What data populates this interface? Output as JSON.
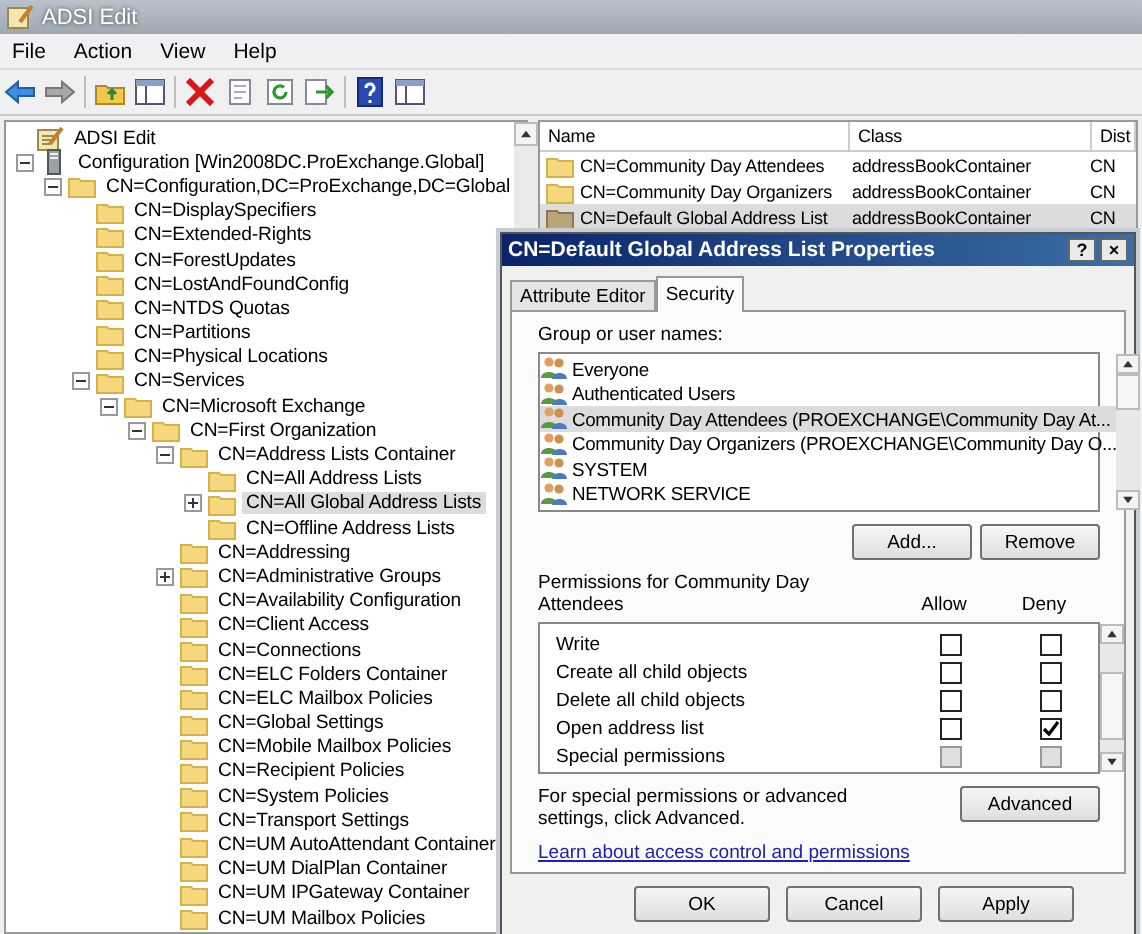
{
  "window": {
    "title": "ADSI Edit"
  },
  "menu": [
    "File",
    "Action",
    "View",
    "Help"
  ],
  "tree": {
    "items": [
      {
        "label": "ADSI Edit",
        "kind": "app",
        "selected": false,
        "children": [
          {
            "label": "Configuration [Win2008DC.ProExchange.Global]",
            "kind": "server",
            "expanded": true,
            "selected": false,
            "children": [
              {
                "label": "CN=Configuration,DC=ProExchange,DC=Global",
                "expanded": true,
                "selected": false,
                "children": [
                  {
                    "label": "CN=DisplaySpecifiers",
                    "selected": false
                  },
                  {
                    "label": "CN=Extended-Rights",
                    "selected": false
                  },
                  {
                    "label": "CN=ForestUpdates",
                    "selected": false
                  },
                  {
                    "label": "CN=LostAndFoundConfig",
                    "selected": false
                  },
                  {
                    "label": "CN=NTDS Quotas",
                    "selected": false
                  },
                  {
                    "label": "CN=Partitions",
                    "selected": false
                  },
                  {
                    "label": "CN=Physical Locations",
                    "selected": false
                  },
                  {
                    "label": "CN=Services",
                    "expanded": true,
                    "selected": false,
                    "children": [
                      {
                        "label": "CN=Microsoft Exchange",
                        "expanded": true,
                        "selected": false,
                        "children": [
                          {
                            "label": "CN=First Organization",
                            "expanded": true,
                            "selected": false,
                            "children": [
                              {
                                "label": "CN=Address Lists Container",
                                "expanded": true,
                                "selected": false,
                                "children": [
                                  {
                                    "label": "CN=All Address Lists",
                                    "selected": false
                                  },
                                  {
                                    "label": "CN=All Global Address Lists",
                                    "expanded": false,
                                    "selected": true
                                  },
                                  {
                                    "label": "CN=Offline Address Lists",
                                    "selected": false
                                  }
                                ]
                              },
                              {
                                "label": "CN=Addressing",
                                "selected": false
                              },
                              {
                                "label": "CN=Administrative Groups",
                                "expanded": false,
                                "selected": false
                              },
                              {
                                "label": "CN=Availability Configuration",
                                "selected": false
                              },
                              {
                                "label": "CN=Client Access",
                                "selected": false
                              },
                              {
                                "label": "CN=Connections",
                                "selected": false
                              },
                              {
                                "label": "CN=ELC Folders Container",
                                "selected": false
                              },
                              {
                                "label": "CN=ELC Mailbox Policies",
                                "selected": false
                              },
                              {
                                "label": "CN=Global Settings",
                                "selected": false
                              },
                              {
                                "label": "CN=Mobile Mailbox Policies",
                                "selected": false
                              },
                              {
                                "label": "CN=Recipient Policies",
                                "selected": false
                              },
                              {
                                "label": "CN=System Policies",
                                "selected": false
                              },
                              {
                                "label": "CN=Transport Settings",
                                "selected": false
                              },
                              {
                                "label": "CN=UM AutoAttendant Container",
                                "selected": false
                              },
                              {
                                "label": "CN=UM DialPlan Container",
                                "selected": false
                              },
                              {
                                "label": "CN=UM IPGateway Container",
                                "selected": false
                              },
                              {
                                "label": "CN=UM Mailbox Policies",
                                "selected": false
                              }
                            ]
                          }
                        ]
                      }
                    ]
                  }
                ]
              }
            ]
          }
        ]
      }
    ]
  },
  "list": {
    "columns": [
      "Name",
      "Class",
      "Dist"
    ],
    "rows": [
      {
        "name": "CN=Community Day Attendees",
        "class": "addressBookContainer",
        "column_3": "CN",
        "selected": false
      },
      {
        "name": "CN=Community Day Organizers",
        "class": "addressBookContainer",
        "column_3": "CN",
        "selected": false
      },
      {
        "name": "CN=Default Global Address List",
        "class": "addressBookContainer",
        "column_3": "CN",
        "selected": true
      }
    ]
  },
  "dialog": {
    "title": "CN=Default Global Address List Properties",
    "help": "?",
    "close": "×",
    "tabs": [
      {
        "label": "Attribute Editor",
        "selected": false
      },
      {
        "label": "Security",
        "selected": true
      }
    ],
    "group_label": "Group or user names:",
    "principals": [
      {
        "name": "Everyone",
        "selected": false
      },
      {
        "name": "Authenticated Users",
        "selected": false
      },
      {
        "name": "Community Day Attendees (PROEXCHANGE\\Community Day At...",
        "selected": true
      },
      {
        "name": "Community Day Organizers (PROEXCHANGE\\Community Day O...",
        "selected": false
      },
      {
        "name": "SYSTEM",
        "selected": false
      },
      {
        "name": "NETWORK SERVICE",
        "selected": false
      }
    ],
    "principal_buttons": [
      "Add...",
      "Remove"
    ],
    "permissions_label": "Permissions for Community Day Attendees",
    "allow_header": "Allow",
    "deny_header": "Deny",
    "permissions": [
      {
        "name": "Write",
        "allow": false,
        "deny": false,
        "disabled": false
      },
      {
        "name": "Create all child objects",
        "allow": false,
        "deny": false,
        "disabled": false
      },
      {
        "name": "Delete all child objects",
        "allow": false,
        "deny": false,
        "disabled": false
      },
      {
        "name": "Open address list",
        "allow": false,
        "deny": true,
        "disabled": false
      },
      {
        "name": "Special permissions",
        "allow": false,
        "deny": false,
        "disabled": true
      }
    ],
    "advanced_note": "For special permissions or advanced settings, click Advanced.",
    "advanced_button": "Advanced",
    "link": "Learn about access control and permissions",
    "buttons": [
      "OK",
      "Cancel",
      "Apply"
    ]
  }
}
